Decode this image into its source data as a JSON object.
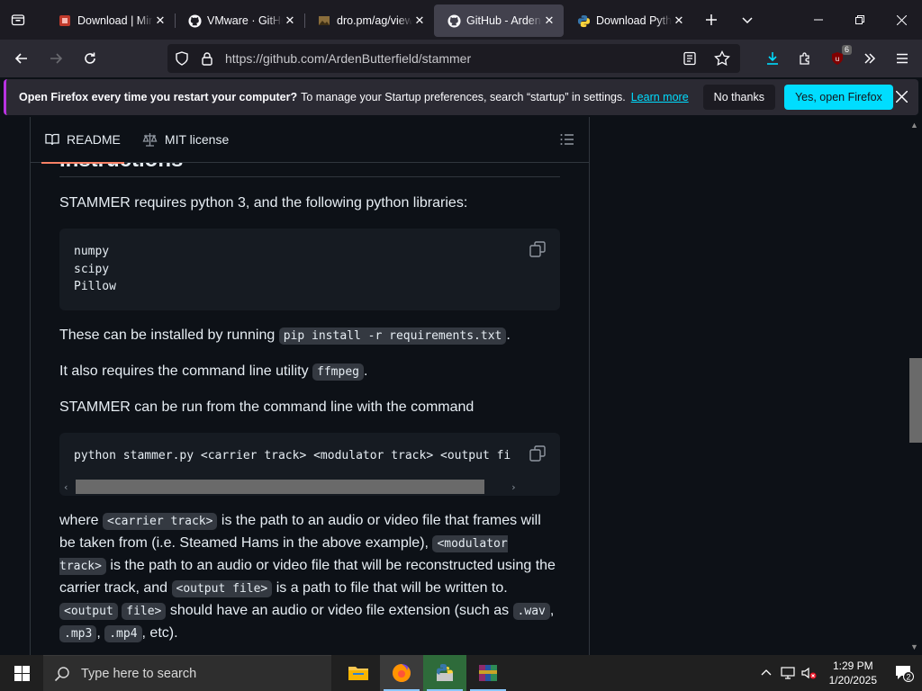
{
  "browser": {
    "tabs": [
      {
        "title": "Download | Mir",
        "icon": "page-icon",
        "active": false
      },
      {
        "title": "VMware · GitHub",
        "icon": "github-icon",
        "active": false
      },
      {
        "title": "dro.pm/ag/view",
        "icon": "image-icon",
        "active": false
      },
      {
        "title": "GitHub - ArdenButterfield/stammer",
        "icon": "github-icon",
        "active": true
      },
      {
        "title": "Download Python",
        "icon": "python-icon",
        "active": false
      }
    ],
    "url": "https://github.com/ArdenButterfield/stammer",
    "extensions_badge": "6"
  },
  "notification": {
    "bold": "Open Firefox every time you restart your computer?",
    "message": "To manage your Startup preferences, search “startup” in settings.",
    "link": "Learn more",
    "no_button": "No thanks",
    "yes_button": "Yes, open Firefox"
  },
  "readme": {
    "tab_readme": "README",
    "tab_license": "MIT license",
    "section_heading": "Instructions",
    "p1": "STAMMER requires python 3, and the following python libraries:",
    "requirements": [
      "numpy",
      "scipy",
      "Pillow"
    ],
    "p2_before": "These can be installed by running",
    "p2_code": "pip install -r requirements.txt",
    "p2_after": ".",
    "p3_before": "It also requires the command line utility",
    "p3_code": "ffmpeg",
    "p3_after": ".",
    "p4": "STAMMER can be run from the command line with the command",
    "command": "python stammer.py <carrier track> <modulator track> <output fi",
    "p5": {
      "t1": "where",
      "c1": "<carrier track>",
      "t2": "is the path to an audio or video file that frames will be taken from (i.e. Steamed Hams in the above example),",
      "c2": "<modulator track>",
      "t3": "is the path to an audio or video file that will be reconstructed using the carrier track, and",
      "c3": "<output file>",
      "t4": "is a path to file that will be written to.",
      "c4a": "<output",
      "c4b": "file>",
      "t5": "should have an audio or video file extension (such as",
      "c5": ".wav",
      "t6": ",",
      "c6": ".mp3",
      "t7": ",",
      "c7": ".mp4",
      "t8": ", etc)."
    }
  },
  "taskbar": {
    "search_placeholder": "Type here to search",
    "time": "1:29 PM",
    "date": "1/20/2025",
    "notifications_count": "2"
  },
  "colors": {
    "accent": "#00ddff",
    "github_tab_underline": "#f78166",
    "page_bg": "#0d1117"
  }
}
